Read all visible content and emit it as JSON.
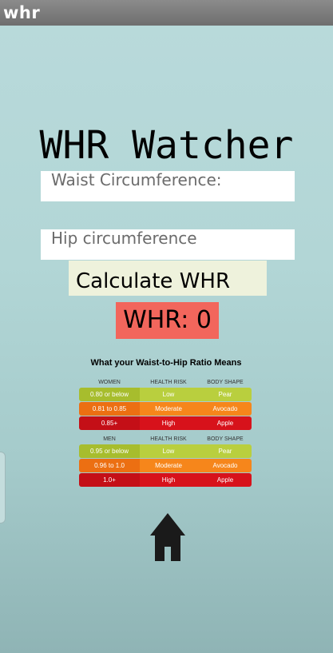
{
  "window": {
    "title": "whr"
  },
  "app": {
    "title": "WHR Watcher"
  },
  "form": {
    "waist_placeholder": "Waist Circumference:",
    "hip_placeholder": "Hip circumference",
    "calculate_label": "Calculate WHR"
  },
  "result": {
    "text": "WHR: 0"
  },
  "chart_data": {
    "type": "table",
    "title": "What your Waist-to-Hip Ratio Means",
    "women": {
      "headers": [
        "WOMEN",
        "HEALTH RISK",
        "BODY SHAPE"
      ],
      "rows": [
        {
          "ratio": "0.80 or below",
          "risk": "Low",
          "shape": "Pear",
          "color": "#b9cf3e",
          "color_dark": "#a7bd2d"
        },
        {
          "ratio": "0.81 to 0.85",
          "risk": "Moderate",
          "shape": "Avocado",
          "color": "#f6861b",
          "color_dark": "#ec6f12"
        },
        {
          "ratio": "0.85+",
          "risk": "High",
          "shape": "Apple",
          "color": "#d7121b",
          "color_dark": "#c40f17"
        }
      ]
    },
    "men": {
      "headers": [
        "MEN",
        "HEALTH RISK",
        "BODY SHAPE"
      ],
      "rows": [
        {
          "ratio": "0.95 or below",
          "risk": "Low",
          "shape": "Pear",
          "color": "#b9cf3e",
          "color_dark": "#a7bd2d"
        },
        {
          "ratio": "0.96 to 1.0",
          "risk": "Moderate",
          "shape": "Avocado",
          "color": "#f6861b",
          "color_dark": "#ec6f12"
        },
        {
          "ratio": "1.0+",
          "risk": "High",
          "shape": "Apple",
          "color": "#d7121b",
          "color_dark": "#c40f17"
        }
      ]
    }
  },
  "nav": {
    "home_icon": "home-icon"
  }
}
